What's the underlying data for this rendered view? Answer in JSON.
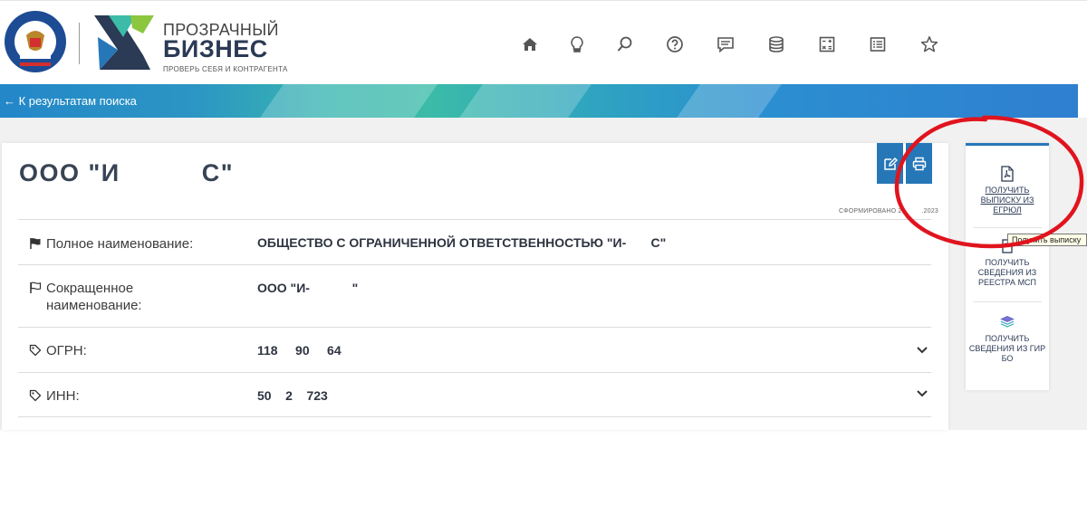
{
  "header": {
    "fns_logo_text": "ФЕДЕРАЛЬНАЯ НАЛОГОВАЯ СЛУЖБА",
    "brand_line1": "ПРОЗРАЧНЫЙ",
    "brand_line2": "БИЗНЕС",
    "brand_slogan": "ПРОВЕРЬ СЕБЯ И КОНТРАГЕНТА",
    "nav_icons": [
      "home-icon",
      "lightbulb-icon",
      "search-icon",
      "help-icon",
      "chat-icon",
      "database-icon",
      "calculator-icon",
      "list-icon",
      "star-icon"
    ]
  },
  "banner": {
    "back_link": "← К результатам поиска"
  },
  "card": {
    "title_part1": "ООО \"И",
    "title_part2": "С\"",
    "formed_label": "СФОРМИРОВАНО 2",
    "formed_suffix": ".2023",
    "rows": [
      {
        "label": "Полное наименование:",
        "value": "ОБЩЕСТВО С ОГРАНИЧЕННОЙ ОТВЕТСТВЕННОСТЬЮ \"И-       С\""
      },
      {
        "label": "Сокращенное наименование:",
        "value": "ООО \"И-            \""
      },
      {
        "label": "ОГРН:",
        "value": "118     90     64"
      },
      {
        "label": "ИНН:",
        "value": "50    2    723"
      }
    ]
  },
  "side_panel": {
    "items": [
      {
        "label": "ПОЛУЧИТЬ ВЫПИСКУ ИЗ ЕГРЮЛ"
      },
      {
        "label": "ПОЛУЧИТЬ СВЕДЕНИЯ ИЗ РЕЕСТРА МСП"
      },
      {
        "label": "ПОЛУЧИТЬ СВЕДЕНИЯ ИЗ ГИР БО"
      }
    ],
    "tooltip": "Получить выписку"
  },
  "colors": {
    "accent": "#2677b8",
    "annotation": "#e0141e",
    "banner_teal": "#3bbba8"
  }
}
